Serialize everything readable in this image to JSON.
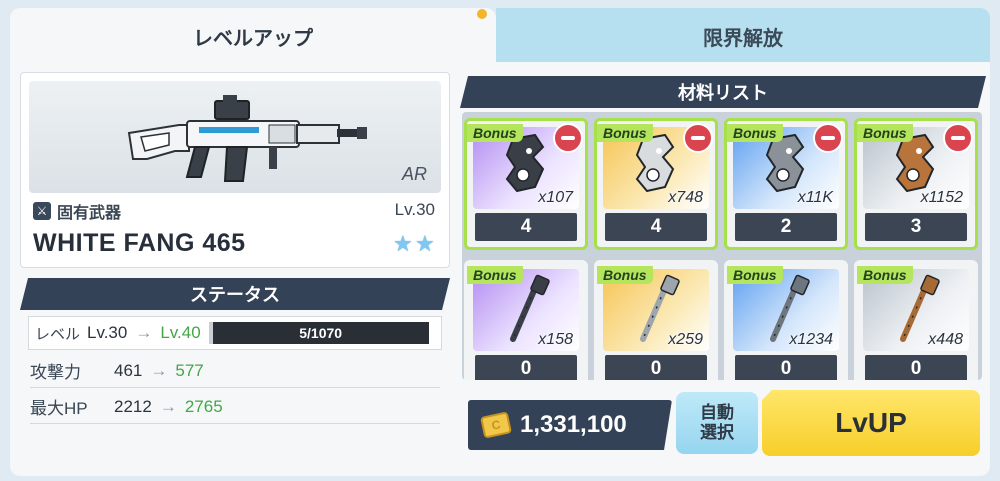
{
  "tabs": {
    "level_up": "レベルアップ",
    "limit_break": "限界解放"
  },
  "weapon": {
    "class": "AR",
    "unique_label": "固有武器",
    "level": "Lv.30",
    "name": "WHITE FANG 465",
    "stars": 2
  },
  "status": {
    "header": "ステータス",
    "level": {
      "label": "レベル",
      "from": "Lv.30",
      "arrow": "→",
      "to": "Lv.40",
      "exp": "5/1070"
    },
    "attack": {
      "label": "攻撃力",
      "from": "461",
      "arrow": "→",
      "to": "577"
    },
    "max_hp": {
      "label": "最大HP",
      "from": "2212",
      "arrow": "→",
      "to": "2765"
    }
  },
  "materials": {
    "header": "材料リスト",
    "bonus_label": "Bonus",
    "items": [
      {
        "rarity": "purple",
        "shape": "part",
        "count": "x107",
        "selected": "4",
        "tint": "#3a3f47"
      },
      {
        "rarity": "gold",
        "shape": "part",
        "count": "x748",
        "selected": "4",
        "tint": "#d9dcdf"
      },
      {
        "rarity": "blue",
        "shape": "part",
        "count": "x11K",
        "selected": "2",
        "tint": "#8a9199"
      },
      {
        "rarity": "grey",
        "shape": "part",
        "count": "x1152",
        "selected": "3",
        "tint": "#b8743a"
      },
      {
        "rarity": "purple",
        "shape": "pin",
        "count": "x158",
        "selected": "0",
        "tint": "#3a3f47"
      },
      {
        "rarity": "gold",
        "shape": "pin",
        "count": "x259",
        "selected": "0",
        "tint": "#9ea5ac"
      },
      {
        "rarity": "blue",
        "shape": "pin",
        "count": "x1234",
        "selected": "0",
        "tint": "#6d757e"
      },
      {
        "rarity": "grey",
        "shape": "pin",
        "count": "x448",
        "selected": "0",
        "tint": "#a86a34"
      }
    ]
  },
  "footer": {
    "credits": "1,331,100",
    "auto_select_line1": "自動",
    "auto_select_line2": "選択",
    "lvup": "LvUP"
  },
  "colors": {
    "accent_green": "#44a648",
    "header_navy": "#334256",
    "bonus_green": "#b4e55c",
    "lvup_yellow": "#f7cf2a"
  }
}
